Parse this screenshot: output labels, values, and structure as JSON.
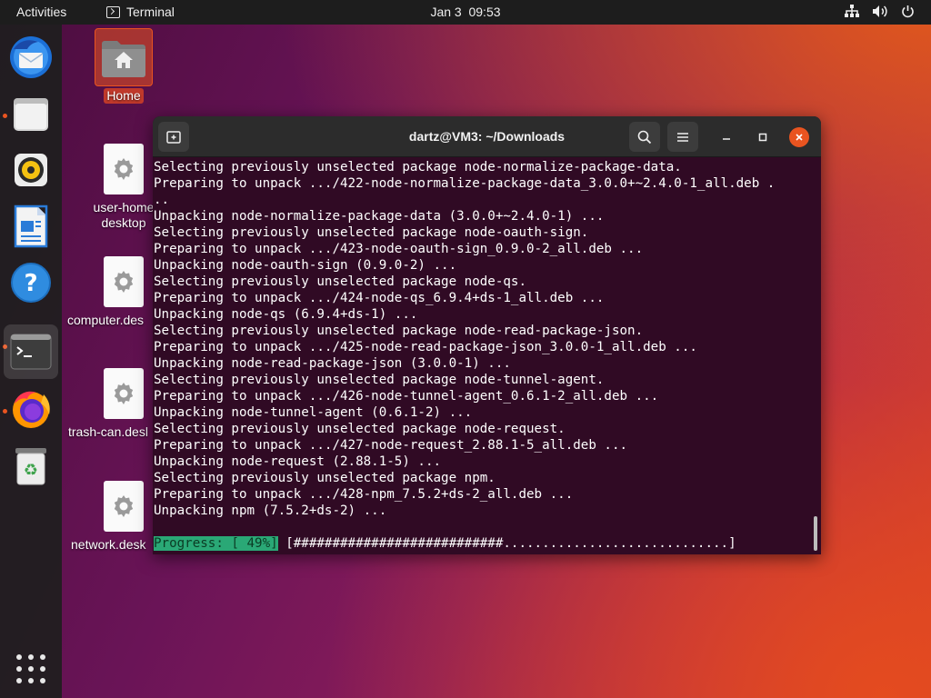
{
  "topbar": {
    "activities": "Activities",
    "app_name": "Terminal",
    "date": "Jan 3",
    "time": "09:53",
    "tray_icons": [
      "network-icon",
      "volume-icon",
      "power-icon"
    ]
  },
  "dock": {
    "items": [
      {
        "name": "thunderbird-icon",
        "running": false
      },
      {
        "name": "files-icon",
        "running": true
      },
      {
        "name": "rhythmbox-icon",
        "running": false
      },
      {
        "name": "writer-icon",
        "running": false
      },
      {
        "name": "help-icon",
        "running": false
      },
      {
        "name": "terminal-icon",
        "running": true,
        "active": true
      },
      {
        "name": "firefox-icon",
        "running": true
      },
      {
        "name": "trash-icon",
        "running": false
      }
    ],
    "show_apps_icon": "grid-icon"
  },
  "desktop": {
    "icons": [
      {
        "label": "Home",
        "kind": "home-folder-icon",
        "selected": true
      },
      {
        "label_lines": [
          "user-home",
          "desktop"
        ],
        "kind": "settings-file-icon"
      },
      {
        "label": "computer.des",
        "kind": "settings-file-icon"
      },
      {
        "label": "trash-can.desl",
        "kind": "settings-file-icon"
      },
      {
        "label": "network.desk",
        "kind": "settings-file-icon"
      }
    ]
  },
  "terminal": {
    "title": "dartz@VM3: ~/Downloads",
    "new_tab_icon": "new-tab-icon",
    "search_icon": "search-icon",
    "menu_icon": "hamburger-menu-icon",
    "colors": {
      "background": "#300a24",
      "header": "#2c2c2c",
      "close": "#e95420",
      "progress": "#2aa876"
    },
    "lines": [
      "Selecting previously unselected package node-normalize-package-data.",
      "Preparing to unpack .../422-node-normalize-package-data_3.0.0+~2.4.0-1_all.deb .",
      "..",
      "Unpacking node-normalize-package-data (3.0.0+~2.4.0-1) ...",
      "Selecting previously unselected package node-oauth-sign.",
      "Preparing to unpack .../423-node-oauth-sign_0.9.0-2_all.deb ...",
      "Unpacking node-oauth-sign (0.9.0-2) ...",
      "Selecting previously unselected package node-qs.",
      "Preparing to unpack .../424-node-qs_6.9.4+ds-1_all.deb ...",
      "Unpacking node-qs (6.9.4+ds-1) ...",
      "Selecting previously unselected package node-read-package-json.",
      "Preparing to unpack .../425-node-read-package-json_3.0.0-1_all.deb ...",
      "Unpacking node-read-package-json (3.0.0-1) ...",
      "Selecting previously unselected package node-tunnel-agent.",
      "Preparing to unpack .../426-node-tunnel-agent_0.6.1-2_all.deb ...",
      "Unpacking node-tunnel-agent (0.6.1-2) ...",
      "Selecting previously unselected package node-request.",
      "Preparing to unpack .../427-node-request_2.88.1-5_all.deb ...",
      "Unpacking node-request (2.88.1-5) ...",
      "Selecting previously unselected package npm.",
      "Preparing to unpack .../428-npm_7.5.2+ds-2_all.deb ...",
      "Unpacking npm (7.5.2+ds-2) ..."
    ],
    "progress": {
      "label": "Progress: [ 49%]",
      "value": 0.49,
      "bar": "[###########################.............................]"
    }
  }
}
